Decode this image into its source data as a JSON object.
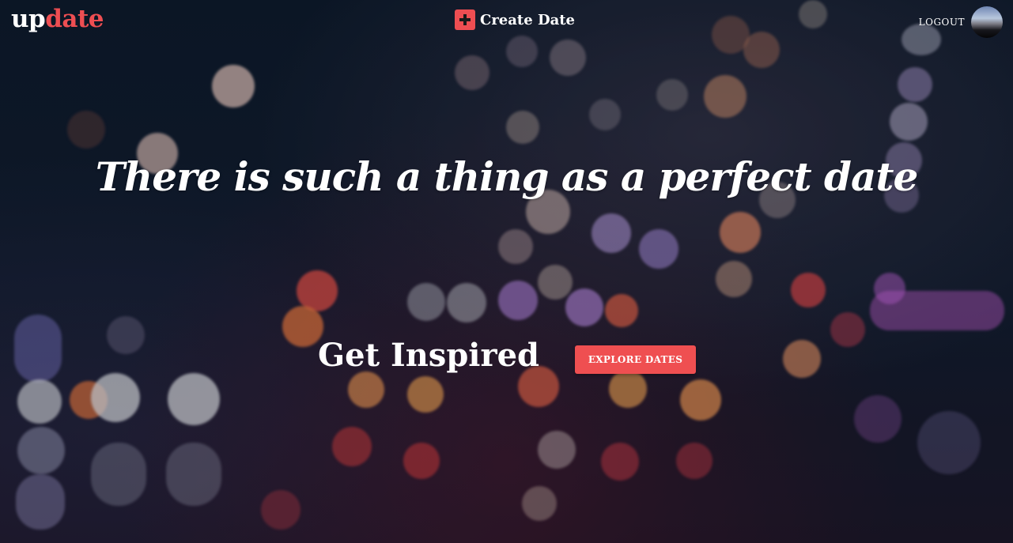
{
  "brand": {
    "part1": "up",
    "part2": "date",
    "accent_color": "#ee4e52"
  },
  "nav": {
    "create_icon": "plus-icon",
    "create_label": "Create Date",
    "logout_label": "LOGOUT",
    "avatar_icon": "user-avatar"
  },
  "hero": {
    "headline": "There is such a thing as a perfect date",
    "cta_text": "Get Inspired",
    "cta_button": "EXPLORE DATES",
    "button_color": "#ef4f51"
  }
}
